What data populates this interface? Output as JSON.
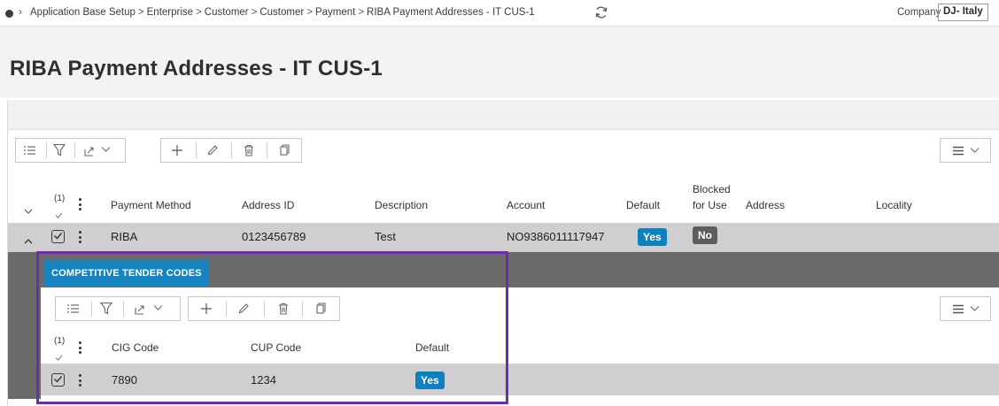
{
  "breadcrumb": {
    "items": [
      "Application Base Setup",
      "Enterprise",
      "Customer",
      "Customer",
      "Payment",
      "RIBA Payment Addresses - IT CUS-1"
    ],
    "separator": ">"
  },
  "company": {
    "label": "Company",
    "value": "DJ- Italy"
  },
  "page": {
    "title": "RIBA Payment Addresses - IT CUS-1"
  },
  "main_table": {
    "selection_count": "(1)",
    "columns": {
      "payment_method": "Payment Method",
      "address_id": "Address ID",
      "description": "Description",
      "account": "Account",
      "default": "Default",
      "blocked_line1": "Blocked",
      "blocked_line2": "for Use",
      "address": "Address",
      "locality": "Locality"
    },
    "rows": [
      {
        "payment_method": "RIBA",
        "address_id": "0123456789",
        "description": "Test",
        "account": "NO9386011117947",
        "default": "Yes",
        "blocked_for_use": "No",
        "address": "",
        "locality": ""
      }
    ]
  },
  "detail": {
    "tab_label": "COMPETITIVE TENDER CODES",
    "selection_count": "(1)",
    "columns": {
      "cig_code": "CIG Code",
      "cup_code": "CUP Code",
      "default": "Default"
    },
    "rows": [
      {
        "cig_code": "7890",
        "cup_code": "1234",
        "default": "Yes"
      }
    ]
  },
  "colors": {
    "accent": "#1783bf",
    "yes_badge": "#0f7fbf",
    "no_badge": "#5d5d5f",
    "selected_row": "#cfcfd1",
    "highlight_box": "#6b2fa8"
  },
  "icons": {
    "toolbar": [
      "list-settings-icon",
      "filter-icon",
      "export-icon",
      "chevron-down-icon",
      "add-icon",
      "edit-icon",
      "delete-icon",
      "duplicate-icon"
    ],
    "view_menu": "hamburger-icon",
    "refresh": "refresh-icon"
  }
}
